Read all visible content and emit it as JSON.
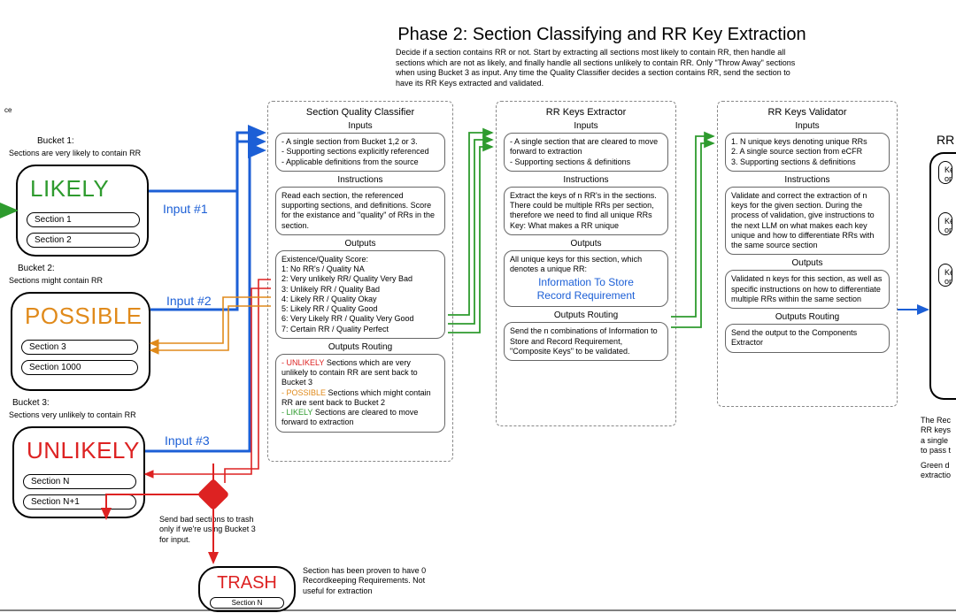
{
  "header": {
    "title": "Phase 2: Section Classifying and RR Key Extraction",
    "description": "Decide if a section contains RR or not. Start by extracting all sections most likely to contain RR, then handle all sections which are not as likely, and finally handle all sections unlikely to contain RR. Only \"Throw Away\" sections when using Bucket 3 as input. Any time the Quality Classifier decides a section contains RR, send the section to have its RR Keys extracted and validated."
  },
  "left_text_fragment": "ce",
  "buckets": {
    "b1": {
      "label": "Bucket 1:",
      "sub": "Sections are very likely to contain RR",
      "name": "LIKELY",
      "items": [
        "Section 1",
        "Section 2"
      ]
    },
    "b2": {
      "label": "Bucket 2:",
      "sub": "Sections might contain RR",
      "name": "POSSIBLE",
      "items": [
        "Section 3",
        "Section 1000"
      ]
    },
    "b3": {
      "label": "Bucket 3:",
      "sub": "Sections very unlikely to contain RR",
      "name": "UNLIKELY",
      "items": [
        "Section N",
        "Section N+1"
      ]
    }
  },
  "inputs": {
    "i1": "Input #1",
    "i2": "Input #2",
    "i3": "Input #3"
  },
  "trash": {
    "name": "TRASH",
    "item": "Section N",
    "side_note": "Send bad sections to trash only if we're using Bucket 3 for input.",
    "right_note": "Section has been proven to have 0 Recordkeeping Requirements. Not useful for extraction"
  },
  "classifier": {
    "title": "Section Quality Classifier",
    "inputs_h": "Inputs",
    "inputs": "- A single section from Bucket 1,2 or 3.\n- Supporting sections explicitly referenced\n- Applicable definitions from the source",
    "instr_h": "Instructions",
    "instr": "Read each section, the referenced supporting sections, and definitions. Score for the existance and \"quality\" of RRs in the section.",
    "outputs_h": "Outputs",
    "score_header": "Existence/Quality Score:",
    "scores": {
      "s1": "1: No RR's / Quality NA",
      "s2": "2: Very unlikely RR/ Quality Very Bad",
      "s3": "3: Unlikely RR / Quality Bad",
      "s4": "4: Likely RR / Quality Okay",
      "s5": "5: Likely RR / Quality Good",
      "s6": "6: Very Likely RR / Quality Very Good",
      "s7": "7: Certain RR / Quality Perfect"
    },
    "routing_h": "Outputs Routing",
    "routing": {
      "unlikely_tag": "- UNLIKELY",
      "unlikely_text": " Sections which are very unlikely to contain RR are sent back to Bucket 3",
      "possible_tag": "- POSSIBLE",
      "possible_text": " Sections which might contain RR are sent back to Bucket 2",
      "likely_tag": "- LIKELY",
      "likely_text": " Sections are cleared to move forward to extraction"
    }
  },
  "extractor": {
    "title": "RR Keys Extractor",
    "inputs_h": "Inputs",
    "inputs": "- A single section that are cleared to move forward to extraction\n- Supporting sections & definitions",
    "instr_h": "Instructions",
    "instr": "Extract the keys of n RR's in the sections. There could be multiple RRs per section, therefore we need to find all unique RRs\nKey: What makes a RR unique",
    "outputs_h": "Outputs",
    "outputs_text": "All unique keys for this section, which denotes a unique RR:",
    "key1": "Information To Store",
    "key2": "Record Requirement",
    "routing_h": "Outputs Routing",
    "routing": "Send the n combinations of Information to Store and Record Requirement, \"Composite Keys\" to be validated."
  },
  "validator": {
    "title": "RR Keys Validator",
    "inputs_h": "Inputs",
    "inputs": "1. N unique keys denoting unique RRs\n2. A single source section from eCFR\n3. Supporting sections & definitions",
    "instr_h": "Instructions",
    "instr": "Validate and correct the extraction of n keys for the given section. During the process of validation, give instructions to the next LLM on what makes each key unique and how to differentiate RRs with the same source section",
    "outputs_h": "Outputs",
    "outputs": "Validated n keys for this section, as well as specific instructions on how to differentiate multiple RRs within the same section",
    "routing_h": "Outputs Routing",
    "routing": "Send the output to the Components Extractor"
  },
  "rr_right": {
    "title_frag": "RR",
    "row1a": "Ke",
    "row1b": "op",
    "row2a": "Ke",
    "row2b": "op",
    "row3a": "Ke",
    "row3b": "op",
    "note1": "The Rec",
    "note2": "RR keys",
    "note3": "a single",
    "note4": "to pass t",
    "note5": "Green d",
    "note6": "extractio"
  }
}
